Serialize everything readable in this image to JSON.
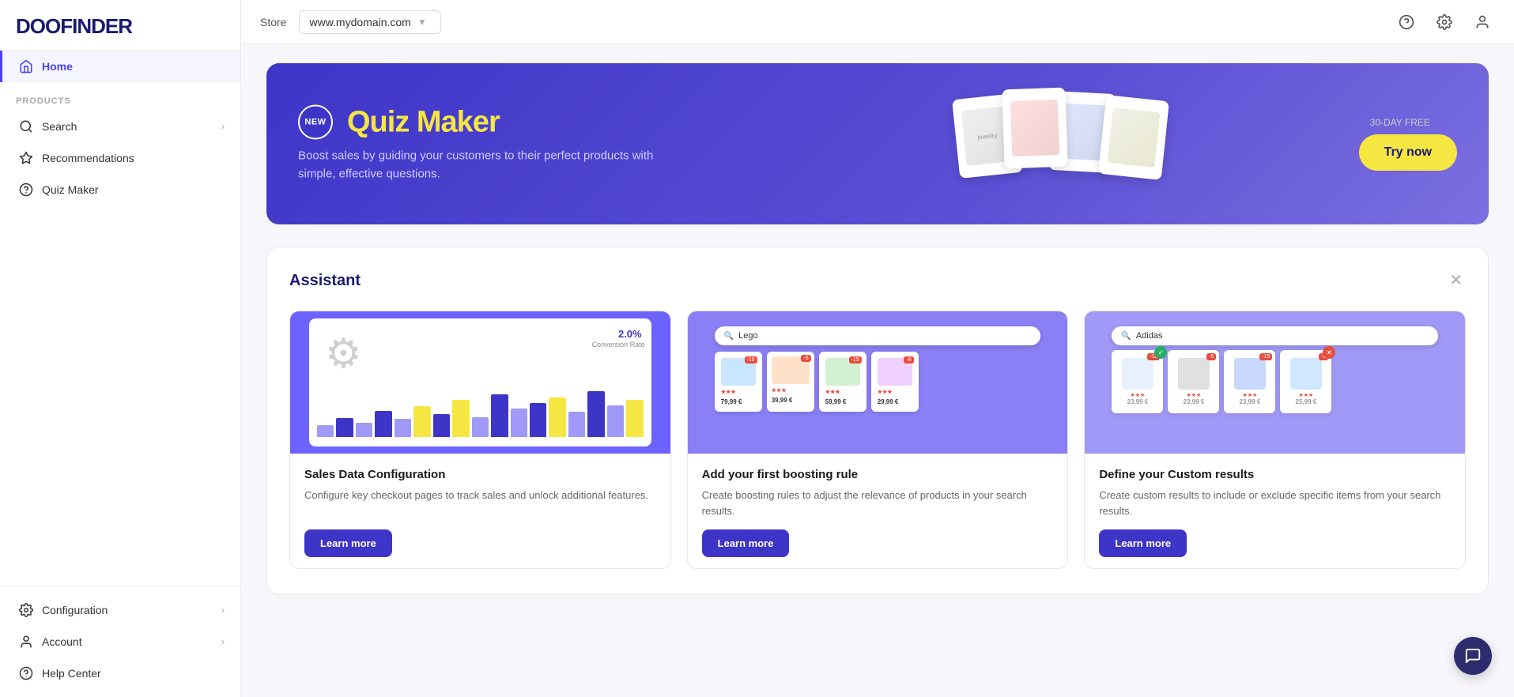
{
  "brand": {
    "name": "DOOFINDER",
    "logo_prefix": "DOO",
    "logo_suffix": "FINDER"
  },
  "topbar": {
    "store_label": "Store",
    "store_value": "www.mydomain.com",
    "trial_label": "30-DAY FREE"
  },
  "sidebar": {
    "sections": [
      {
        "label": "",
        "items": [
          {
            "id": "home",
            "label": "Home",
            "active": true,
            "has_chevron": false
          }
        ]
      },
      {
        "label": "PRODUCTS",
        "items": [
          {
            "id": "search",
            "label": "Search",
            "active": false,
            "has_chevron": true
          },
          {
            "id": "recommendations",
            "label": "Recommendations",
            "active": false,
            "has_chevron": false
          },
          {
            "id": "quiz-maker",
            "label": "Quiz Maker",
            "active": false,
            "has_chevron": false
          }
        ]
      }
    ],
    "bottom_items": [
      {
        "id": "configuration",
        "label": "Configuration",
        "has_chevron": true
      },
      {
        "id": "account",
        "label": "Account",
        "has_chevron": true
      },
      {
        "id": "help-center",
        "label": "Help Center",
        "has_chevron": false
      }
    ]
  },
  "banner": {
    "badge_text": "NEW",
    "title": "Quiz Maker",
    "subtitle": "Boost sales by guiding your customers to their perfect products with simple, effective questions.",
    "trial_label": "30-DAY FREE",
    "cta_label": "Try now"
  },
  "assistant": {
    "title": "Assistant",
    "cards": [
      {
        "id": "sales-data",
        "title": "Sales Data Configuration",
        "description": "Configure key checkout pages to track sales and unlock additional features.",
        "cta_label": "Learn more"
      },
      {
        "id": "boosting-rule",
        "title": "Add your first boosting rule",
        "description": "Create boosting rules to adjust the relevance of products in your search results.",
        "cta_label": "Learn more",
        "search_placeholder": "Lego"
      },
      {
        "id": "custom-results",
        "title": "Define your Custom results",
        "description": "Create custom results to include or exclude specific items from your search results.",
        "cta_label": "Learn more",
        "search_placeholder": "Adidas"
      }
    ]
  },
  "chart": {
    "conversion_label": "2.0%",
    "conversion_sublabel": "Conversion Rate",
    "bars": [
      4,
      7,
      5,
      9,
      6,
      11,
      8,
      13,
      7,
      15,
      10,
      12,
      14,
      9,
      16,
      11,
      13
    ]
  }
}
